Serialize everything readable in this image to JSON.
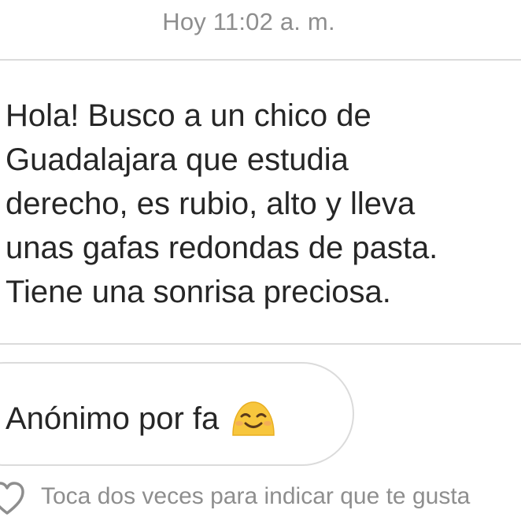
{
  "conversation": {
    "timestamp": "Hoy 11:02 a. m.",
    "messages": [
      {
        "lines": [
          "Hola! Busco a un chico de",
          "Guadalajara que estudia",
          "derecho, es rubio, alto y lleva",
          "unas gafas redondas de pasta.",
          "Tiene una sonrisa preciosa."
        ]
      },
      {
        "text": "Anónimo por fa",
        "emoji": "smiling-face-with-smiling-eyes-icon"
      }
    ],
    "like_hint": "Toca dos veces para indicar que te gusta"
  },
  "colors": {
    "timestamp": "#8e8e8e",
    "bubble_border": "#dbdbdb",
    "message_text": "#262626",
    "emoji_fill": "#f7c63d"
  }
}
